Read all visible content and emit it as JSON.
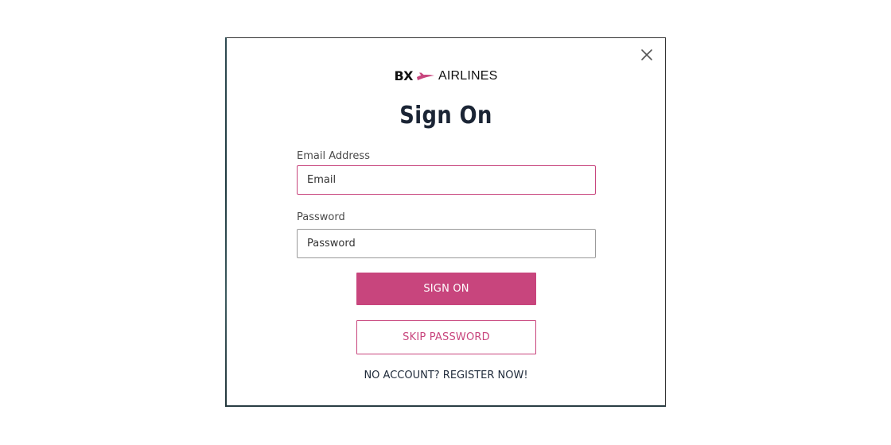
{
  "modal": {
    "close_icon": "close-icon",
    "brand": {
      "code": "BX",
      "name": "AIRLINES",
      "logo_icon": "airplane-swoosh-icon",
      "accent_color": "#c8457d"
    },
    "title": "Sign On",
    "email": {
      "label": "Email Address",
      "placeholder": "Email",
      "value": ""
    },
    "password": {
      "label": "Password",
      "placeholder": "Password",
      "value": ""
    },
    "sign_on_button": "SIGN ON",
    "skip_password_button": "SKIP PASSWORD",
    "register_link": "NO ACCOUNT? REGISTER NOW!"
  }
}
